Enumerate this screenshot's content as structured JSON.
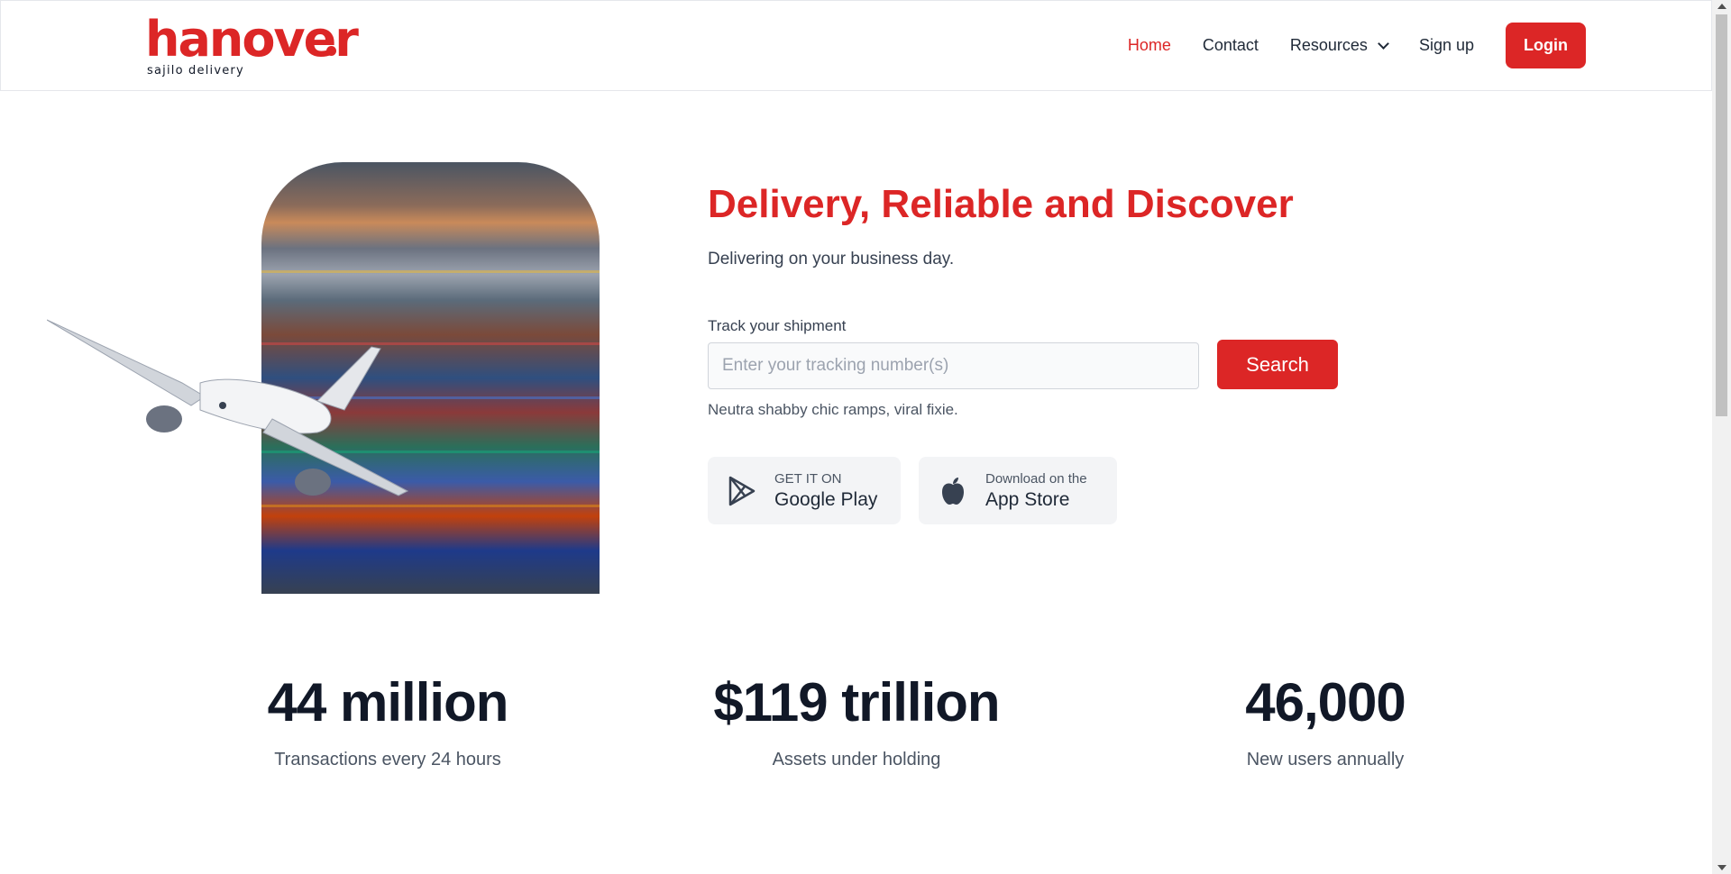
{
  "brand": {
    "name": "hanover",
    "tagline": "sajilo delivery",
    "accent": "#dc2626"
  },
  "nav": {
    "items": [
      {
        "label": "Home",
        "active": true
      },
      {
        "label": "Contact"
      },
      {
        "label": "Resources",
        "has_dropdown": true
      },
      {
        "label": "Sign up"
      }
    ],
    "login_label": "Login"
  },
  "hero": {
    "image_icon": "cargo-port-photo",
    "plane_icon": "airplane-icon",
    "headline": "Delivery, Reliable and Discover",
    "subheadline": "Delivering on your business day.",
    "track": {
      "label": "Track your shipment",
      "placeholder": "Enter your tracking number(s)",
      "value": "",
      "button_label": "Search",
      "helper": "Neutra shabby chic ramps, viral fixie."
    },
    "stores": [
      {
        "icon": "google-play-icon",
        "small": "GET IT ON",
        "big": "Google Play"
      },
      {
        "icon": "apple-icon",
        "small": "Download on the",
        "big": "App Store"
      }
    ]
  },
  "stats": [
    {
      "value": "44 million",
      "label": "Transactions every 24 hours"
    },
    {
      "value": "$119 trillion",
      "label": "Assets under holding"
    },
    {
      "value": "46,000",
      "label": "New users annually"
    }
  ]
}
